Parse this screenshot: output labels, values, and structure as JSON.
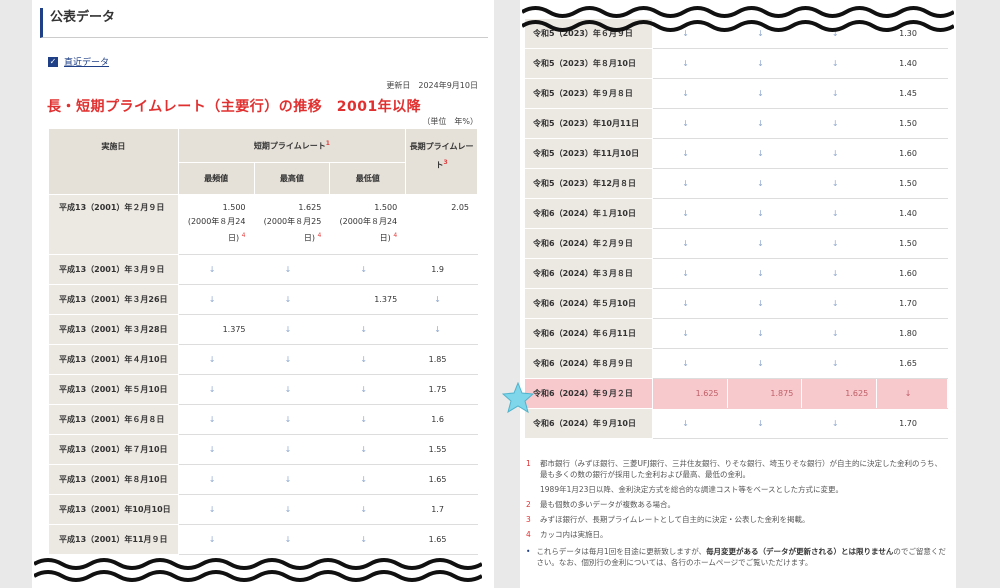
{
  "left": {
    "section_title": "公表データ",
    "recent_link": "直近データ",
    "updated": "更新日　2024年9月10日",
    "title": "長・短期プライムレート（主要行）の推移　2001年以降",
    "unit": "（単位　年%）",
    "headers": {
      "date": "実施日",
      "short": "短期プライムレート",
      "short_sup": "1",
      "long": "長期プライムレート",
      "long_sup": "3",
      "mode": "最頻値",
      "max": "最高値",
      "min": "最低値"
    },
    "first_row": {
      "date": "平成13（2001）年２月９日",
      "mode": "1.500",
      "mode_note": "(2000年８月24日)",
      "max": "1.625",
      "max_note": "(2000年８月25日)",
      "min": "1.500",
      "min_note": "(2000年８月24日)",
      "note_sup": "4",
      "long": "2.05"
    },
    "rows": [
      {
        "date": "平成13（2001）年３月９日",
        "mode": "↓",
        "max": "↓",
        "min": "↓",
        "long": "1.9"
      },
      {
        "date": "平成13（2001）年３月26日",
        "mode": "↓",
        "max": "↓",
        "min": "1.375",
        "long": "↓"
      },
      {
        "date": "平成13（2001）年３月28日",
        "mode": "1.375",
        "max": "↓",
        "min": "↓",
        "long": "↓"
      },
      {
        "date": "平成13（2001）年４月10日",
        "mode": "↓",
        "max": "↓",
        "min": "↓",
        "long": "1.85"
      },
      {
        "date": "平成13（2001）年５月10日",
        "mode": "↓",
        "max": "↓",
        "min": "↓",
        "long": "1.75"
      },
      {
        "date": "平成13（2001）年６月８日",
        "mode": "↓",
        "max": "↓",
        "min": "↓",
        "long": "1.6"
      },
      {
        "date": "平成13（2001）年７月10日",
        "mode": "↓",
        "max": "↓",
        "min": "↓",
        "long": "1.55"
      },
      {
        "date": "平成13（2001）年８月10日",
        "mode": "↓",
        "max": "↓",
        "min": "↓",
        "long": "1.65"
      },
      {
        "date": "平成13（2001）年10月10日",
        "mode": "↓",
        "max": "↓",
        "min": "↓",
        "long": "1.7"
      },
      {
        "date": "平成13（2001）年11月９日",
        "mode": "↓",
        "max": "↓",
        "min": "↓",
        "long": "1.65"
      }
    ]
  },
  "right": {
    "rows": [
      {
        "date": "令和5（2023）年６月９日",
        "mode": "↓",
        "max": "↓",
        "min": "↓",
        "long": "1.30"
      },
      {
        "date": "令和5（2023）年８月10日",
        "mode": "↓",
        "max": "↓",
        "min": "↓",
        "long": "1.40"
      },
      {
        "date": "令和5（2023）年９月８日",
        "mode": "↓",
        "max": "↓",
        "min": "↓",
        "long": "1.45"
      },
      {
        "date": "令和5（2023）年10月11日",
        "mode": "↓",
        "max": "↓",
        "min": "↓",
        "long": "1.50"
      },
      {
        "date": "令和5（2023）年11月10日",
        "mode": "↓",
        "max": "↓",
        "min": "↓",
        "long": "1.60"
      },
      {
        "date": "令和5（2023）年12月８日",
        "mode": "↓",
        "max": "↓",
        "min": "↓",
        "long": "1.50"
      },
      {
        "date": "令和6（2024）年１月10日",
        "mode": "↓",
        "max": "↓",
        "min": "↓",
        "long": "1.40"
      },
      {
        "date": "令和6（2024）年２月９日",
        "mode": "↓",
        "max": "↓",
        "min": "↓",
        "long": "1.50"
      },
      {
        "date": "令和6（2024）年３月８日",
        "mode": "↓",
        "max": "↓",
        "min": "↓",
        "long": "1.60"
      },
      {
        "date": "令和6（2024）年５月10日",
        "mode": "↓",
        "max": "↓",
        "min": "↓",
        "long": "1.70"
      },
      {
        "date": "令和6（2024）年６月11日",
        "mode": "↓",
        "max": "↓",
        "min": "↓",
        "long": "1.80"
      },
      {
        "date": "令和6（2024）年８月９日",
        "mode": "↓",
        "max": "↓",
        "min": "↓",
        "long": "1.65"
      },
      {
        "date": "令和6（2024）年９月２日",
        "mode": "1.625",
        "max": "1.875",
        "min": "1.625",
        "long": "↓",
        "highlight": true
      },
      {
        "date": "令和6（2024）年９月10日",
        "mode": "↓",
        "max": "↓",
        "min": "↓",
        "long": "1.70"
      }
    ],
    "notes": [
      {
        "n": "1",
        "text": "都市銀行（みずほ銀行、三菱UFJ銀行、三井住友銀行、りそな銀行、埼玉りそな銀行）が自主的に決定した金利のうち、最も多くの数の銀行が採用した金利および最高、最低の金利。"
      },
      {
        "n": "",
        "text": "1989年1月23日以降、金利決定方式を総合的な調達コスト等をベースとした方式に変更。"
      },
      {
        "n": "2",
        "text": "最も個数の多いデータが複数ある場合。"
      },
      {
        "n": "3",
        "text": "みずほ銀行が、長期プライムレートとして自主的に決定・公表した金利を掲載。"
      },
      {
        "n": "4",
        "text": "カッコ内は実施日。"
      }
    ],
    "bullet_before": "これらデータは毎月1回を目途に更新致しますが、",
    "bullet_bold": "毎月変更がある（データが更新される）とは限りません",
    "bullet_after": "のでご留意ください。なお、個別行の金利については、各行のホームページでご覧いただけます。"
  },
  "colors": {
    "accent": "#1f3f86",
    "title_red": "#e03030",
    "header_bg": "#e5e0d8",
    "highlight": "#f7c8cc",
    "star": "#7fd6ea"
  }
}
